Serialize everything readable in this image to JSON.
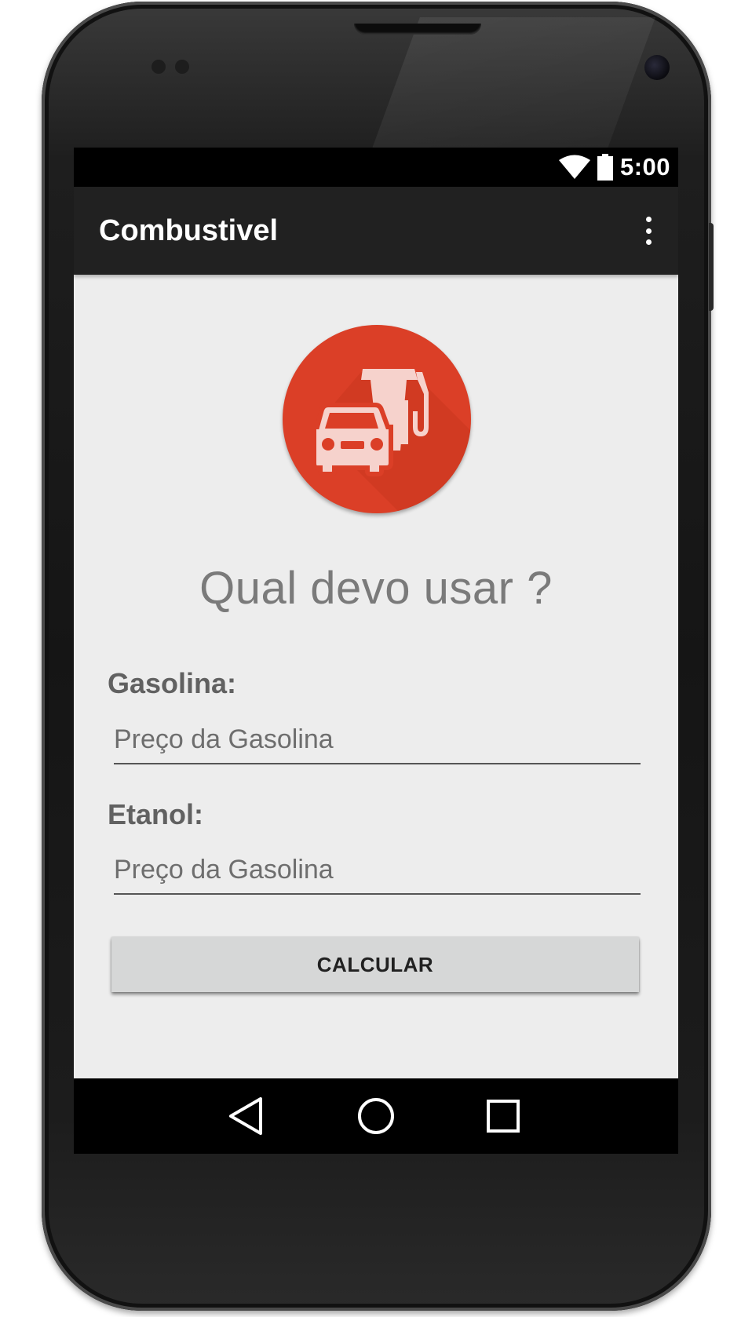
{
  "status_bar": {
    "time": "5:00",
    "icons": [
      "wifi-icon",
      "battery-icon"
    ]
  },
  "app_bar": {
    "title": "Combustivel",
    "menu_icon": "overflow-menu-icon"
  },
  "logo": {
    "icon": "fuel-station-car-icon",
    "background_color": "#db3f27",
    "shadow_color": "#c03620",
    "foreground_color": "#f6d2cc"
  },
  "main": {
    "headline": "Qual devo usar ?",
    "gasolina": {
      "label": "Gasolina:",
      "placeholder": "Preço da Gasolina",
      "value": ""
    },
    "etanol": {
      "label": "Etanol:",
      "placeholder": "Preço da Gasolina",
      "value": ""
    },
    "calculate_button": "CALCULAR"
  },
  "nav_bar": {
    "buttons": [
      "back-icon",
      "home-icon",
      "recents-icon"
    ]
  },
  "colors": {
    "app_bar": "#212121",
    "screen_background": "#ededed",
    "button_background": "#d6d7d7",
    "accent": "#db3f27"
  }
}
